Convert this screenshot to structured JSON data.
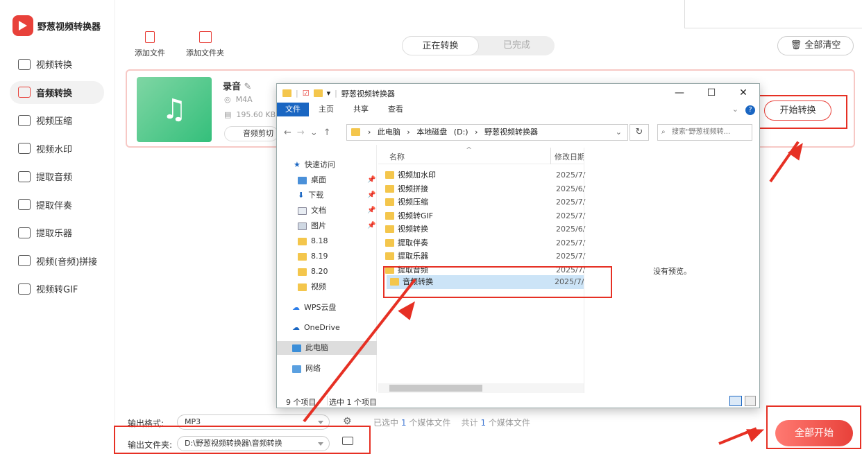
{
  "app": {
    "name": "野葱视频转换器"
  },
  "sidebar": {
    "items": [
      {
        "label": "视频转换",
        "icon": "video-convert-icon"
      },
      {
        "label": "音频转换",
        "icon": "audio-convert-icon"
      },
      {
        "label": "视频压缩",
        "icon": "video-compress-icon"
      },
      {
        "label": "视频水印",
        "icon": "watermark-icon"
      },
      {
        "label": "提取音频",
        "icon": "extract-audio-icon"
      },
      {
        "label": "提取伴奏",
        "icon": "extract-accompaniment-icon"
      },
      {
        "label": "提取乐器",
        "icon": "guitar-icon"
      },
      {
        "label": "视频(音频)拼接",
        "icon": "merge-icon"
      },
      {
        "label": "视频转GIF",
        "icon": "gif-icon"
      }
    ]
  },
  "toolbar": {
    "add_file": "添加文件",
    "add_folder": "添加文件夹",
    "clear_all": "全部清空"
  },
  "tabs": {
    "converting": "正在转换",
    "done": "已完成"
  },
  "file": {
    "name": "录音",
    "format": "M4A",
    "size": "195.60 KB",
    "cut": "音频剪切",
    "start": "开始转换"
  },
  "bottom": {
    "format_label": "输出格式:",
    "format_value": "MP3",
    "folder_label": "输出文件夹:",
    "folder_value": "D:\\野葱视频转换器\\音频转换",
    "status": {
      "selected_prefix": "已选中",
      "selected_count": "1",
      "selected_suffix": "个媒体文件",
      "total_prefix": "共计",
      "total_count": "1",
      "total_suffix": "个媒体文件"
    },
    "start_all": "全部开始"
  },
  "dialog": {
    "title": "野葱视频转换器",
    "ribbon": [
      "文件",
      "主页",
      "共享",
      "查看"
    ],
    "path": [
      "此电脑",
      "本地磁盘 (D:)",
      "野葱视频转换器"
    ],
    "search_placeholder": "搜索\"野葱视频转...",
    "tree": [
      "快速访问",
      "桌面",
      "下载",
      "文档",
      "图片",
      "8.18",
      "8.19",
      "8.20",
      "视频",
      "WPS云盘",
      "OneDrive",
      "此电脑",
      "网络"
    ],
    "columns": {
      "name": "名称",
      "date": "修改日期"
    },
    "files": [
      {
        "name": "视频加水印",
        "date": "2025/7/"
      },
      {
        "name": "视频拼接",
        "date": "2025/6/"
      },
      {
        "name": "视频压缩",
        "date": "2025/7/"
      },
      {
        "name": "视频转GIF",
        "date": "2025/7/"
      },
      {
        "name": "视频转换",
        "date": "2025/6/"
      },
      {
        "name": "提取伴奏",
        "date": "2025/7/"
      },
      {
        "name": "提取乐器",
        "date": "2025/7/"
      },
      {
        "name": "提取音频",
        "date": "2025/7/"
      },
      {
        "name": "音频转换",
        "date": "2025/7/"
      }
    ],
    "no_preview": "没有预览。",
    "item_count": "9 个项目",
    "selected_count": "选中 1 个项目"
  },
  "colors": {
    "accent": "#e8413a",
    "annotation": "#e63024",
    "selection": "#cce4f7"
  }
}
